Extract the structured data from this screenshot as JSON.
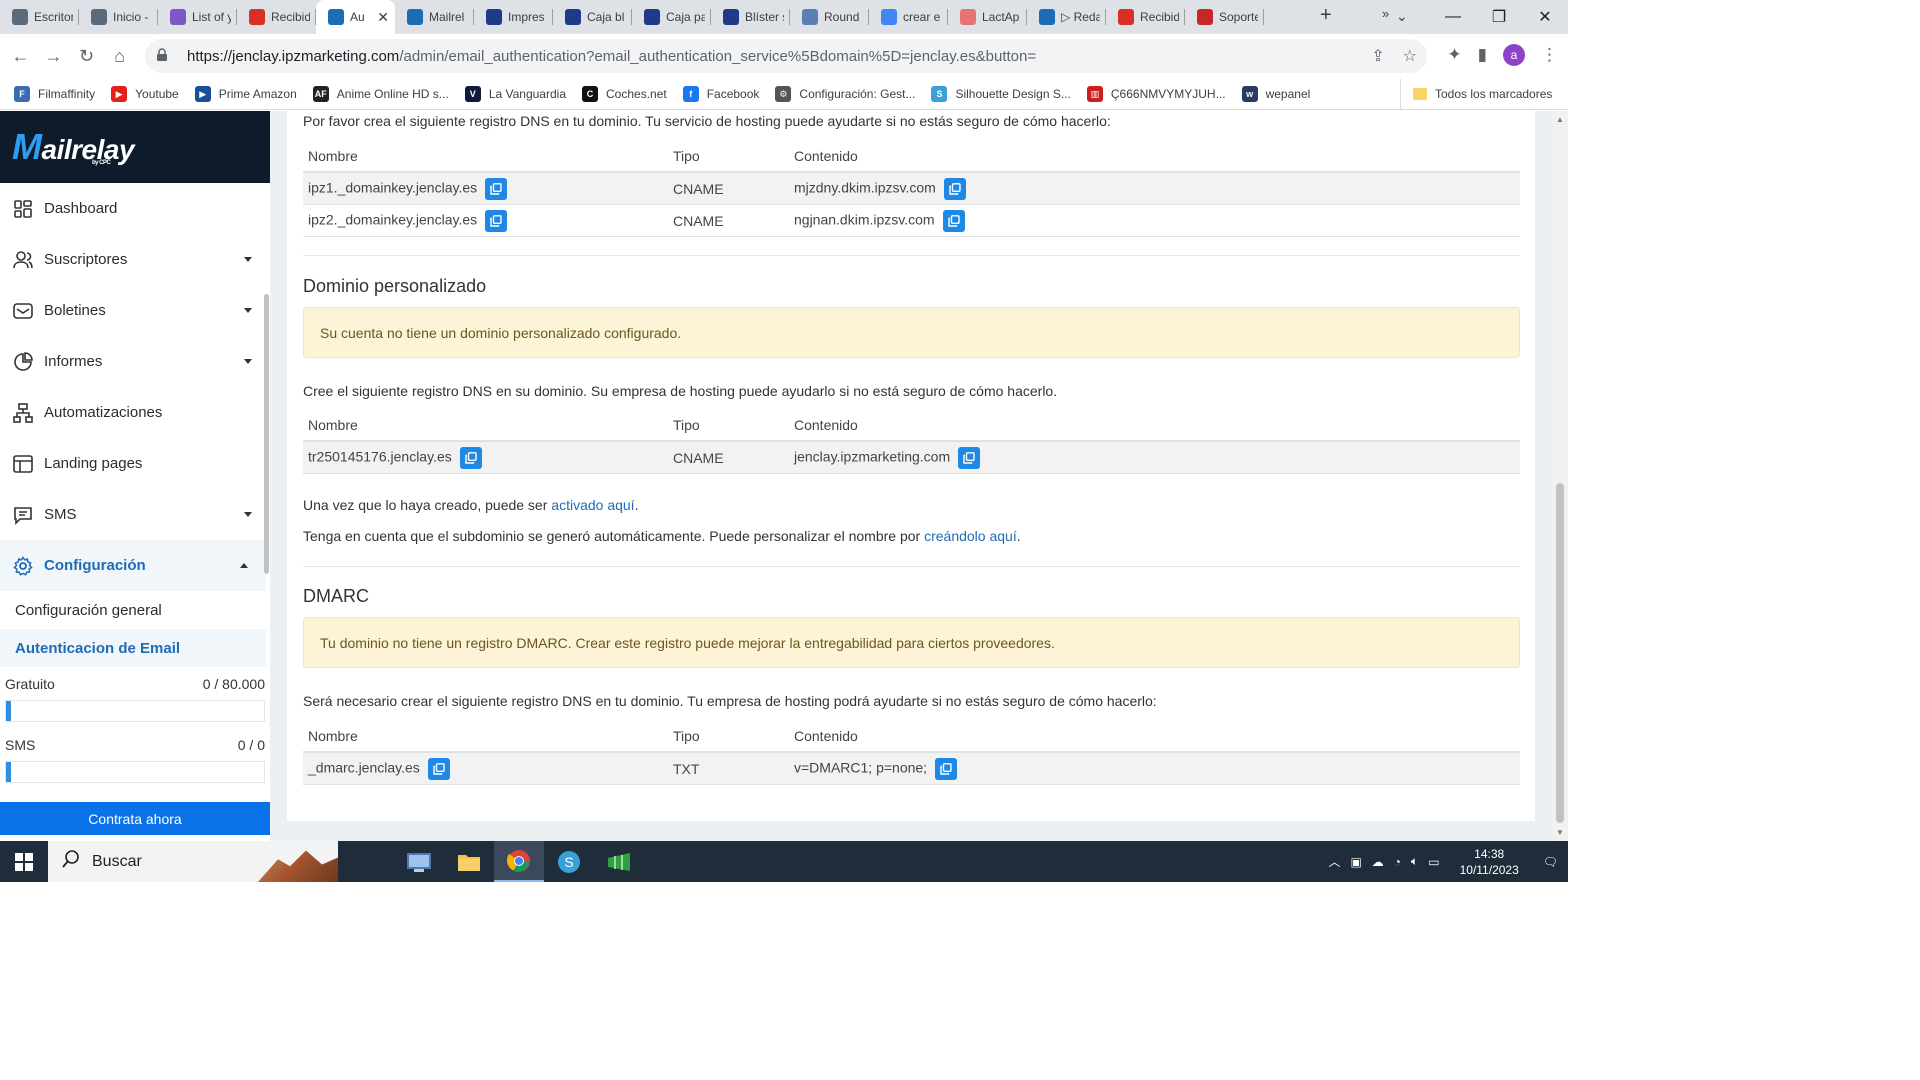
{
  "browser": {
    "tabs": [
      {
        "label": "Escritorio",
        "icon": "edge-icon",
        "color": "#5b6b7c"
      },
      {
        "label": "Inicio -",
        "icon": "edge-icon",
        "color": "#5b6b7c"
      },
      {
        "label": "List of y",
        "icon": "grid-icon",
        "color": "#7e57c2"
      },
      {
        "label": "Recibid",
        "icon": "gmail-icon",
        "color": "#d93025"
      },
      {
        "label": "Au",
        "icon": "mail-icon",
        "color": "#1e6bb8",
        "active": true
      },
      {
        "label": "Mailrel",
        "icon": "mail-icon",
        "color": "#1e6bb8"
      },
      {
        "label": "Impres",
        "icon": "b-icon",
        "color": "#1f3a8a"
      },
      {
        "label": "Caja bl",
        "icon": "b-icon",
        "color": "#1f3a8a"
      },
      {
        "label": "Caja pa",
        "icon": "b-icon",
        "color": "#1f3a8a"
      },
      {
        "label": "Blíster s",
        "icon": "b-icon",
        "color": "#1f3a8a"
      },
      {
        "label": "Round",
        "icon": "folder-icon",
        "color": "#5a7fb0"
      },
      {
        "label": "crear e",
        "icon": "google-icon",
        "color": "#4285f4"
      },
      {
        "label": "LactAp",
        "icon": "lact-icon",
        "color": "#e57373"
      },
      {
        "label": "▷ Reda",
        "icon": "mail-icon",
        "color": "#1e6bb8"
      },
      {
        "label": "Recibid",
        "icon": "gmail-icon",
        "color": "#d93025"
      },
      {
        "label": "Soporte",
        "icon": "w-icon",
        "color": "#c62828"
      }
    ],
    "url_host": "https://jenclay.ipzmarketing.com",
    "url_path": "/admin/email_authentication?email_authentication_service%5Bdomain%5D=jenclay.es&button=",
    "bookmarks": [
      {
        "label": "Filmaffinity",
        "color": "#3b6bb5",
        "glyph": "F"
      },
      {
        "label": "Youtube",
        "color": "#e62117",
        "glyph": "▶"
      },
      {
        "label": "Prime Amazon",
        "color": "#1a4f9c",
        "glyph": "▶"
      },
      {
        "label": "Anime Online HD s...",
        "color": "#222222",
        "glyph": "AF"
      },
      {
        "label": "La Vanguardia",
        "color": "#0d1b3d",
        "glyph": "V"
      },
      {
        "label": "Coches.net",
        "color": "#111111",
        "glyph": "C"
      },
      {
        "label": "Facebook",
        "color": "#1877f2",
        "glyph": "f"
      },
      {
        "label": "Configuración: Gest...",
        "color": "#555555",
        "glyph": "⚙"
      },
      {
        "label": "Silhouette Design S...",
        "color": "#3aa0d8",
        "glyph": "S"
      },
      {
        "label": "Ç666NMVYMYJUH...",
        "color": "#cc1f1f",
        "glyph": "▥"
      },
      {
        "label": "wepanel",
        "color": "#2b3a67",
        "glyph": "w"
      }
    ],
    "all_bookmarks": "Todos los marcadores",
    "more": "»",
    "avatar": "a"
  },
  "sidebar": {
    "logo": "ailrelay",
    "logo_m": "M",
    "logo_by": "by CPC",
    "items": [
      {
        "label": "Dashboard",
        "icon": "dashboard-icon",
        "caret": false
      },
      {
        "label": "Suscriptores",
        "icon": "users-icon",
        "caret": true
      },
      {
        "label": "Boletines",
        "icon": "envelope-icon",
        "caret": true
      },
      {
        "label": "Informes",
        "icon": "pie-chart-icon",
        "caret": true
      },
      {
        "label": "Automatizaciones",
        "icon": "flow-icon",
        "caret": false
      },
      {
        "label": "Landing pages",
        "icon": "page-icon",
        "caret": false
      },
      {
        "label": "SMS",
        "icon": "sms-icon",
        "caret": true
      },
      {
        "label": "Configuración",
        "icon": "gear-icon",
        "caret": true,
        "active": true
      }
    ],
    "subitems": [
      {
        "label": "Configuración general"
      },
      {
        "label": "Autenticacion de Email",
        "active": true
      }
    ],
    "quota": [
      {
        "label": "Gratuito",
        "value": "0 / 80.000",
        "fill": 0
      },
      {
        "label": "SMS",
        "value": "0 / 0",
        "fill": 0
      }
    ],
    "buy_label": "Contrata ahora"
  },
  "main": {
    "dkim_intro": "Por favor crea el siguiente registro DNS en tu dominio. Tu servicio de hosting puede ayudarte si no estás seguro de cómo hacerlo:",
    "columns": [
      "Nombre",
      "Tipo",
      "Contenido"
    ],
    "dkim_rows": [
      {
        "name": "ipz1._domainkey.jenclay.es",
        "type": "CNAME",
        "content": "mjzdny.dkim.ipzsv.com"
      },
      {
        "name": "ipz2._domainkey.jenclay.es",
        "type": "CNAME",
        "content": "ngjnan.dkim.ipzsv.com"
      }
    ],
    "custom_domain": {
      "title": "Dominio personalizado",
      "alert": "Su cuenta no tiene un dominio personalizado configurado.",
      "intro": "Cree el siguiente registro DNS en su dominio. Su empresa de hosting puede ayudarlo si no está seguro de cómo hacerlo.",
      "rows": [
        {
          "name": "tr250145176.jenclay.es",
          "type": "CNAME",
          "content": "jenclay.ipzmarketing.com"
        }
      ],
      "activate_prefix": "Una vez que lo haya creado, puede ser ",
      "activate_link": "activado aquí",
      "activate_suffix": ".",
      "note_prefix": "Tenga en cuenta que el subdominio se generó automáticamente. Puede personalizar el nombre por ",
      "note_link": "creándolo aquí",
      "note_suffix": "."
    },
    "dmarc": {
      "title": "DMARC",
      "alert": "Tu dominio no tiene un registro DMARC. Crear este registro puede mejorar la entregabilidad para ciertos proveedores.",
      "intro": "Será necesario crear el siguiente registro DNS en tu dominio. Tu empresa de hosting podrá ayudarte si no estás seguro de cómo hacerlo:",
      "rows": [
        {
          "name": "_dmarc.jenclay.es",
          "type": "TXT",
          "content": "v=DMARC1; p=none;"
        }
      ]
    }
  },
  "taskbar": {
    "search": "Buscar",
    "time": "14:38",
    "date": "10/11/2023"
  }
}
